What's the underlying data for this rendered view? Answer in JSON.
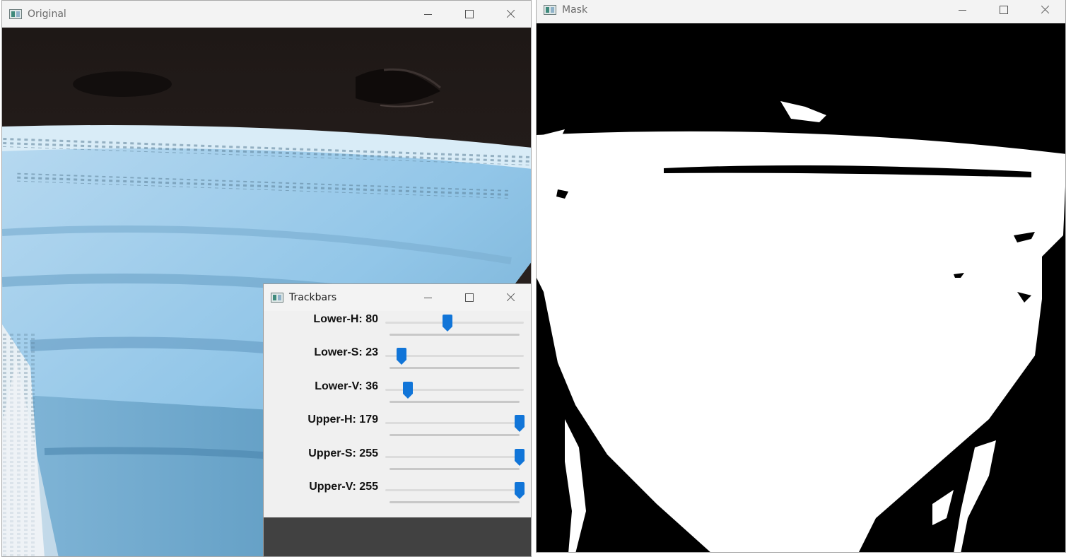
{
  "windows": {
    "original": {
      "title": "Original"
    },
    "mask": {
      "title": "Mask"
    },
    "trackbars": {
      "title": "Trackbars",
      "sliders": [
        {
          "label": "Lower-H: 80",
          "value": 80,
          "max": 179
        },
        {
          "label": "Lower-S: 23",
          "value": 23,
          "max": 255
        },
        {
          "label": "Lower-V: 36",
          "value": 36,
          "max": 255
        },
        {
          "label": "Upper-H: 179",
          "value": 179,
          "max": 179
        },
        {
          "label": "Upper-S: 255",
          "value": 255,
          "max": 255
        },
        {
          "label": "Upper-V: 255",
          "value": 255,
          "max": 255
        }
      ]
    }
  },
  "colors": {
    "slider_thumb": "#1175d8",
    "mask_background": "#000000",
    "mask_foreground": "#ffffff",
    "mask_color": "#8fc3e6"
  }
}
